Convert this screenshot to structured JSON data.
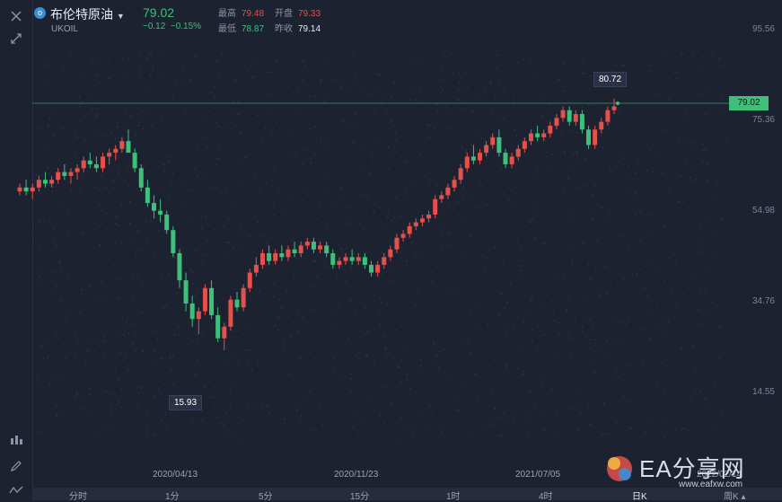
{
  "symbol": {
    "name": "布伦特原油",
    "code": "UKOIL",
    "badge": "o"
  },
  "quote": {
    "price": "79.02",
    "change": "−0.12",
    "change_pct": "−0.15%"
  },
  "stats": [
    {
      "label": "最高",
      "value": "79.48",
      "color": "#e4504b"
    },
    {
      "label": "开盘",
      "value": "79.33",
      "color": "#e4504b"
    },
    {
      "label": "最低",
      "value": "78.87",
      "color": "#3ec07b"
    },
    {
      "label": "昨收",
      "value": "79.14",
      "color": "#e8ecf5"
    }
  ],
  "price_tag": "79.02",
  "high_marker": "80.72",
  "low_marker": "15.93",
  "y_axis": [
    "95.56",
    "75.36",
    "54.98",
    "34.76",
    "14.55"
  ],
  "x_axis": [
    "2020/04/13",
    "2020/11/23",
    "2021/07/05",
    "2022/02/14"
  ],
  "timeframes": [
    "分时",
    "1分",
    "5分",
    "15分",
    "1时",
    "4时",
    "日K",
    "周K ▴"
  ],
  "watermark": {
    "text": "EA分享网",
    "url": "www.eafxw.com"
  },
  "icons": [
    "close-icon",
    "compress-icon",
    "candles-icon",
    "pencil-icon",
    "indicator-icon"
  ],
  "chart_data": {
    "type": "candlestick",
    "ylim": [
      5,
      100
    ],
    "series": [
      {
        "name": "UKOIL",
        "ohlc": [
          [
            57,
            59,
            56,
            58
          ],
          [
            58,
            60,
            56,
            57
          ],
          [
            57,
            59,
            55,
            58
          ],
          [
            58,
            61,
            57,
            60
          ],
          [
            60,
            62,
            58,
            59
          ],
          [
            59,
            61,
            58,
            60
          ],
          [
            60,
            63,
            59,
            62
          ],
          [
            62,
            64,
            60,
            61
          ],
          [
            61,
            63,
            59,
            62
          ],
          [
            62,
            64,
            60,
            63
          ],
          [
            63,
            66,
            62,
            65
          ],
          [
            65,
            67,
            63,
            64
          ],
          [
            64,
            66,
            62,
            63
          ],
          [
            63,
            67,
            62,
            66
          ],
          [
            66,
            68,
            64,
            67
          ],
          [
            67,
            69,
            65,
            68
          ],
          [
            68,
            71,
            67,
            70
          ],
          [
            70,
            73,
            68,
            67
          ],
          [
            67,
            68,
            62,
            63
          ],
          [
            63,
            64,
            57,
            58
          ],
          [
            58,
            60,
            53,
            54
          ],
          [
            54,
            56,
            50,
            52
          ],
          [
            52,
            55,
            49,
            51
          ],
          [
            51,
            52,
            46,
            47
          ],
          [
            47,
            48,
            40,
            41
          ],
          [
            41,
            42,
            32,
            34
          ],
          [
            34,
            36,
            26,
            28
          ],
          [
            28,
            30,
            22,
            24
          ],
          [
            24,
            27,
            20,
            26
          ],
          [
            26,
            33,
            25,
            32
          ],
          [
            32,
            34,
            24,
            25
          ],
          [
            25,
            27,
            18,
            19
          ],
          [
            19,
            23,
            16,
            22
          ],
          [
            22,
            30,
            21,
            29
          ],
          [
            29,
            31,
            26,
            27
          ],
          [
            27,
            33,
            26,
            32
          ],
          [
            32,
            37,
            31,
            36
          ],
          [
            36,
            40,
            35,
            38
          ],
          [
            38,
            42,
            37,
            41
          ],
          [
            41,
            43,
            38,
            39
          ],
          [
            39,
            42,
            38,
            41
          ],
          [
            41,
            43,
            39,
            40
          ],
          [
            40,
            43,
            39,
            42
          ],
          [
            42,
            44,
            40,
            41
          ],
          [
            41,
            44,
            40,
            43
          ],
          [
            43,
            45,
            42,
            44
          ],
          [
            44,
            45,
            41,
            42
          ],
          [
            42,
            44,
            41,
            43
          ],
          [
            43,
            44,
            40,
            41
          ],
          [
            41,
            42,
            37,
            38
          ],
          [
            38,
            40,
            37,
            39
          ],
          [
            39,
            41,
            38,
            40
          ],
          [
            40,
            42,
            38,
            39
          ],
          [
            39,
            41,
            38,
            40
          ],
          [
            40,
            41,
            37,
            38
          ],
          [
            38,
            39,
            35,
            36
          ],
          [
            36,
            39,
            35,
            38
          ],
          [
            38,
            41,
            37,
            40
          ],
          [
            40,
            43,
            39,
            42
          ],
          [
            42,
            46,
            41,
            45
          ],
          [
            45,
            47,
            44,
            46
          ],
          [
            46,
            49,
            45,
            48
          ],
          [
            48,
            50,
            47,
            49
          ],
          [
            49,
            51,
            48,
            50
          ],
          [
            50,
            52,
            49,
            51
          ],
          [
            51,
            56,
            50,
            55
          ],
          [
            55,
            57,
            54,
            56
          ],
          [
            56,
            59,
            55,
            58
          ],
          [
            58,
            61,
            57,
            60
          ],
          [
            60,
            64,
            59,
            63
          ],
          [
            63,
            67,
            62,
            66
          ],
          [
            66,
            69,
            64,
            65
          ],
          [
            65,
            68,
            64,
            67
          ],
          [
            67,
            70,
            66,
            69
          ],
          [
            69,
            72,
            68,
            71
          ],
          [
            71,
            73,
            66,
            67
          ],
          [
            67,
            68,
            63,
            64
          ],
          [
            64,
            67,
            63,
            66
          ],
          [
            66,
            69,
            65,
            68
          ],
          [
            68,
            71,
            67,
            70
          ],
          [
            70,
            73,
            69,
            72
          ],
          [
            72,
            74,
            70,
            71
          ],
          [
            71,
            73,
            70,
            72
          ],
          [
            72,
            75,
            71,
            74
          ],
          [
            74,
            77,
            73,
            76
          ],
          [
            76,
            79,
            75,
            78
          ],
          [
            78,
            79,
            74,
            75
          ],
          [
            75,
            78,
            74,
            77
          ],
          [
            77,
            78,
            72,
            73
          ],
          [
            73,
            74,
            68,
            69
          ],
          [
            69,
            74,
            68,
            73
          ],
          [
            73,
            76,
            72,
            75
          ],
          [
            75,
            79,
            74,
            78
          ],
          [
            78,
            81,
            77,
            79
          ]
        ]
      }
    ]
  }
}
